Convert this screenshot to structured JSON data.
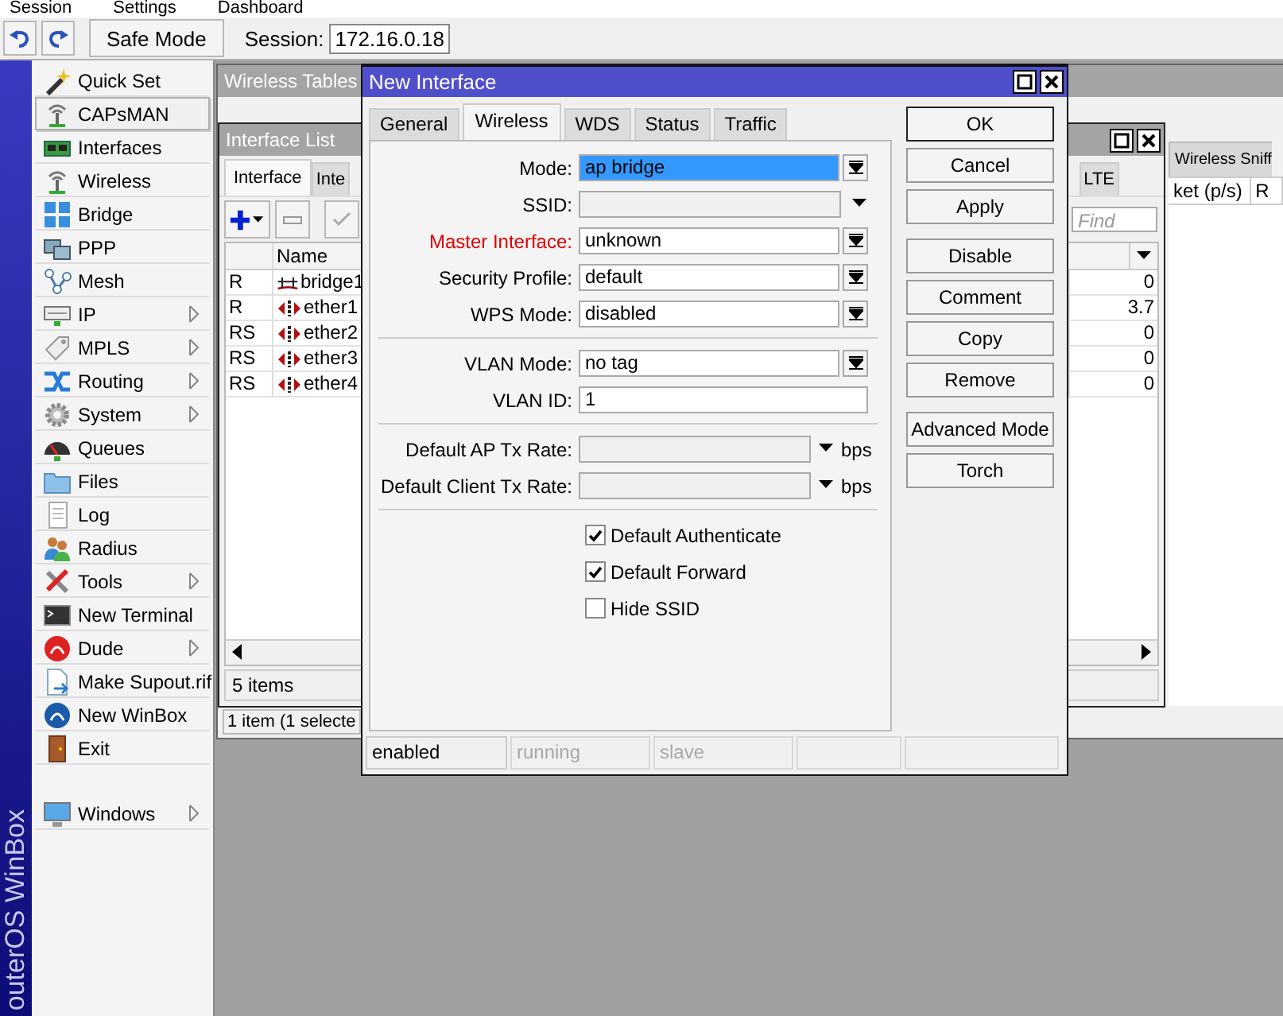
{
  "menu_bar": [
    "Session",
    "Settings",
    "Dashboard"
  ],
  "toolbar": {
    "safe_mode": "Safe Mode",
    "session_label": "Session:",
    "session_value": "172.16.0.18"
  },
  "side_banner": "outerOS WinBox",
  "sidebar": {
    "items": [
      {
        "label": "Quick Set",
        "submenu": false,
        "selected": false
      },
      {
        "label": "CAPsMAN",
        "submenu": false,
        "selected": true
      },
      {
        "label": "Interfaces",
        "submenu": false,
        "selected": false
      },
      {
        "label": "Wireless",
        "submenu": false,
        "selected": false
      },
      {
        "label": "Bridge",
        "submenu": false,
        "selected": false
      },
      {
        "label": "PPP",
        "submenu": false,
        "selected": false
      },
      {
        "label": "Mesh",
        "submenu": false,
        "selected": false
      },
      {
        "label": "IP",
        "submenu": true,
        "selected": false
      },
      {
        "label": "MPLS",
        "submenu": true,
        "selected": false
      },
      {
        "label": "Routing",
        "submenu": true,
        "selected": false
      },
      {
        "label": "System",
        "submenu": true,
        "selected": false
      },
      {
        "label": "Queues",
        "submenu": false,
        "selected": false
      },
      {
        "label": "Files",
        "submenu": false,
        "selected": false
      },
      {
        "label": "Log",
        "submenu": false,
        "selected": false
      },
      {
        "label": "Radius",
        "submenu": false,
        "selected": false
      },
      {
        "label": "Tools",
        "submenu": true,
        "selected": false
      },
      {
        "label": "New Terminal",
        "submenu": false,
        "selected": false
      },
      {
        "label": "Dude",
        "submenu": true,
        "selected": false
      },
      {
        "label": "Make Supout.rif",
        "submenu": false,
        "selected": false
      },
      {
        "label": "New WinBox",
        "submenu": false,
        "selected": false
      },
      {
        "label": "Exit",
        "submenu": false,
        "selected": false
      }
    ],
    "bottom_items": [
      {
        "label": "Windows",
        "submenu": true,
        "selected": false
      }
    ]
  },
  "wireless_tables": {
    "title": "Wireless Tables",
    "tabs": [
      {
        "label": "Wireless Sniff",
        "selected": false
      }
    ],
    "columns": [
      "ket (p/s)",
      "R"
    ],
    "status": "1 item (1 selecte"
  },
  "interface_list": {
    "title": "Interface List",
    "tabs": [
      {
        "label": "Interface",
        "selected": true
      },
      {
        "label": "Inte",
        "selected": false
      },
      {
        "label": "LTE",
        "selected": false
      }
    ],
    "find_placeholder": "Find",
    "columns": [
      "Name"
    ],
    "rows": [
      {
        "flags": "R",
        "kind": "bridge",
        "name": "bridge1",
        "column_3": "0"
      },
      {
        "flags": "R",
        "kind": "ether",
        "name": "ether1",
        "column_3": "3.7"
      },
      {
        "flags": "RS",
        "kind": "ether",
        "name": "ether2",
        "column_3": "0"
      },
      {
        "flags": "RS",
        "kind": "ether",
        "name": "ether3",
        "column_3": "0"
      },
      {
        "flags": "RS",
        "kind": "ether",
        "name": "ether4",
        "column_3": "0"
      }
    ],
    "status": "5 items"
  },
  "new_interface": {
    "title": "New Interface",
    "tabs": [
      {
        "label": "General",
        "selected": false
      },
      {
        "label": "Wireless",
        "selected": true
      },
      {
        "label": "WDS",
        "selected": false
      },
      {
        "label": "Status",
        "selected": false
      },
      {
        "label": "Traffic",
        "selected": false
      }
    ],
    "sections": [
      [
        {
          "kind": "select",
          "label": "Mode:",
          "value": "ap bridge",
          "focused": true,
          "warning": false,
          "disabled": false
        },
        {
          "kind": "combo",
          "label": "SSID:",
          "focused": false,
          "warning": false,
          "disabled": true
        },
        {
          "kind": "select",
          "label": "Master Interface:",
          "value": "unknown",
          "focused": false,
          "warning": true,
          "disabled": false
        },
        {
          "kind": "select",
          "label": "Security Profile:",
          "value": "default",
          "focused": false,
          "warning": false,
          "disabled": false
        },
        {
          "kind": "select",
          "label": "WPS Mode:",
          "value": "disabled",
          "focused": false,
          "warning": false,
          "disabled": false
        }
      ],
      [
        {
          "kind": "select",
          "label": "VLAN Mode:",
          "value": "no tag",
          "focused": false,
          "warning": false,
          "disabled": false
        },
        {
          "kind": "text",
          "label": "VLAN ID:",
          "value": "1",
          "focused": false,
          "warning": false,
          "disabled": false
        }
      ],
      [
        {
          "kind": "rate",
          "label": "Default AP Tx Rate:",
          "unit": "bps",
          "focused": false,
          "warning": false,
          "disabled": true
        },
        {
          "kind": "rate",
          "label": "Default Client Tx Rate:",
          "unit": "bps",
          "focused": false,
          "warning": false,
          "disabled": true
        }
      ]
    ],
    "checkboxes": [
      {
        "label": "Default Authenticate",
        "checked": true
      },
      {
        "label": "Default Forward",
        "checked": true
      },
      {
        "label": "Hide SSID",
        "checked": false
      }
    ],
    "button_groups": [
      [
        {
          "label": "OK",
          "default": true
        },
        {
          "label": "Cancel",
          "default": false
        },
        {
          "label": "Apply",
          "default": false
        }
      ],
      [
        {
          "label": "Disable",
          "default": false
        },
        {
          "label": "Comment",
          "default": false
        },
        {
          "label": "Copy",
          "default": false
        },
        {
          "label": "Remove",
          "default": false
        }
      ],
      [
        {
          "label": "Advanced Mode",
          "default": false
        },
        {
          "label": "Torch",
          "default": false
        }
      ]
    ],
    "status_bar": [
      {
        "text": "enabled",
        "active": true
      },
      {
        "text": "running",
        "active": false
      },
      {
        "text": "slave",
        "active": false
      },
      {
        "active": false
      },
      {
        "active": false
      }
    ]
  }
}
